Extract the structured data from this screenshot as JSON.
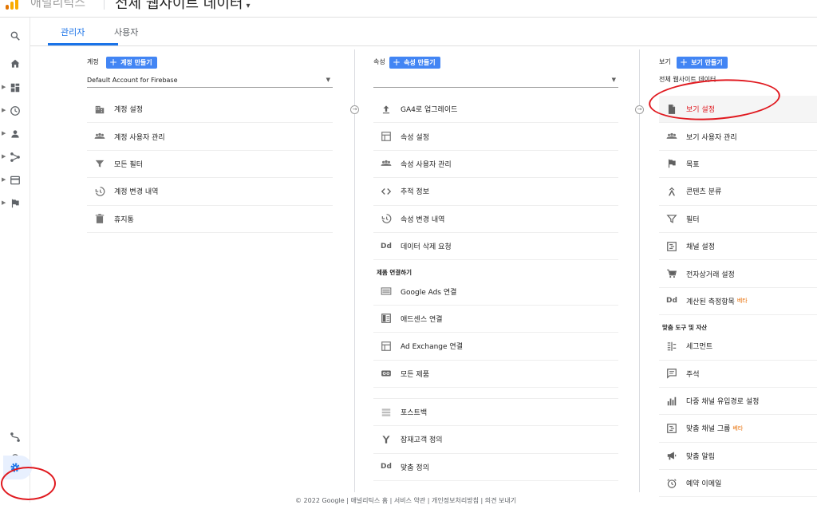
{
  "header": {
    "brand": "애널리틱스",
    "view_name": "전체 웹사이트 데이터",
    "caret": "▾"
  },
  "tabs": [
    {
      "label": "관리자",
      "active": true
    },
    {
      "label": "사용자",
      "active": false
    }
  ],
  "account": {
    "head_label": "계정",
    "create_label": "계정 만들기",
    "selector_value": "Default Account for Firebase",
    "items": [
      {
        "label": "계정 설정",
        "icon": "building-icon"
      },
      {
        "label": "계정 사용자 관리",
        "icon": "people-icon"
      },
      {
        "label": "모든 필터",
        "icon": "filter-icon"
      },
      {
        "label": "계정 변경 내역",
        "icon": "history-icon"
      },
      {
        "label": "휴지통",
        "icon": "trash-icon"
      }
    ]
  },
  "property": {
    "head_label": "속성",
    "create_label": "속성 만들기",
    "selector_value": "",
    "items": [
      {
        "label": "GA4로 업그레이드",
        "icon": "upload-icon"
      },
      {
        "label": "속성 설정",
        "icon": "layout-icon"
      },
      {
        "label": "속성 사용자 관리",
        "icon": "people-icon"
      },
      {
        "label": "추적 정보",
        "icon": "code-icon"
      },
      {
        "label": "속성 변경 내역",
        "icon": "history-icon"
      },
      {
        "label": "데이터 삭제 요청",
        "icon": "dd-icon"
      }
    ],
    "links_section": "제품 연결하기",
    "links": [
      {
        "label": "Google Ads 연결",
        "icon": "ads-icon"
      },
      {
        "label": "애드센스 연결",
        "icon": "adsense-icon"
      },
      {
        "label": "Ad Exchange 연결",
        "icon": "adx-icon"
      },
      {
        "label": "모든 제품",
        "icon": "link-icon"
      }
    ],
    "more": [
      {
        "label": "포스트백",
        "icon": "postback-icon"
      },
      {
        "label": "잠재고객 정의",
        "icon": "audience-icon"
      },
      {
        "label": "맞춤 정의",
        "icon": "dd-icon"
      }
    ]
  },
  "view": {
    "head_label": "보기",
    "create_label": "보기 만들기",
    "selector_value": "전체 웹사이트 데이터",
    "items": [
      {
        "label": "보기 설정",
        "icon": "doc-icon",
        "highlight": true
      },
      {
        "label": "보기 사용자 관리",
        "icon": "people-icon"
      },
      {
        "label": "목표",
        "icon": "flag-icon"
      },
      {
        "label": "콘텐츠 분류",
        "icon": "grouping-icon"
      },
      {
        "label": "필터",
        "icon": "filter-icon"
      },
      {
        "label": "채널 설정",
        "icon": "channel-icon"
      },
      {
        "label": "전자상거래 설정",
        "icon": "cart-icon"
      },
      {
        "label": "계산된 측정항목",
        "icon": "dd-icon",
        "beta": "베타"
      }
    ],
    "tools_section": "맞춤 도구 및 자산",
    "tools": [
      {
        "label": "세그먼트",
        "icon": "segment-icon"
      },
      {
        "label": "주석",
        "icon": "comment-icon"
      },
      {
        "label": "다중 채널 유입경로 설정",
        "icon": "bars-icon"
      },
      {
        "label": "맞춤 채널 그룹",
        "icon": "channel-icon",
        "beta": "베타"
      },
      {
        "label": "맞춤 알림",
        "icon": "megaphone-icon"
      },
      {
        "label": "예약 이메일",
        "icon": "clock-icon"
      }
    ]
  },
  "footer": "© 2022 Google | 애널리틱스 홈 | 서비스 약관 | 개인정보처리방침 | 의견 보내기",
  "colors": {
    "accent": "#1a73e8",
    "button": "#4285f4",
    "annotation": "#e0191f",
    "logo_orange": "#f9ab00",
    "logo_dark": "#e37400"
  }
}
